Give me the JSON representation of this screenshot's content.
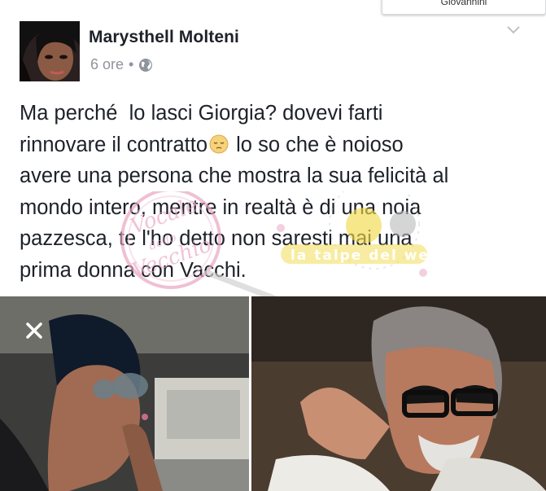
{
  "window": {
    "partial_tab_label": "Giovannini"
  },
  "post": {
    "author": "Marysthell Molteni",
    "timestamp": "6 ore",
    "separator": "•",
    "privacy_icon": "globe-icon",
    "options_icon": "chevron-down-icon",
    "text_lines": [
      "Ma perché  lo lasci Giorgia? dovevi farti",
      "rinnovare il contratto",
      " lo so che è noioso",
      "avere una persona che mostra la sua felicità al",
      "mondo intero, mentre in realtà è di una noia",
      "pazzesca, te l'ho detto non saresti mai una",
      "prima donna con Vacchi."
    ],
    "emoji": "pensive-face-emoji"
  },
  "watermark": {
    "left_text": "Vocale dello Vecchio",
    "right_text": "la talpe del web"
  },
  "photos": {
    "close_icon": "close-icon"
  },
  "colors": {
    "text": "#1d2129",
    "meta": "#90949c",
    "watermark_pink": "#e7a3c1",
    "watermark_yellow": "#f2d94a"
  }
}
